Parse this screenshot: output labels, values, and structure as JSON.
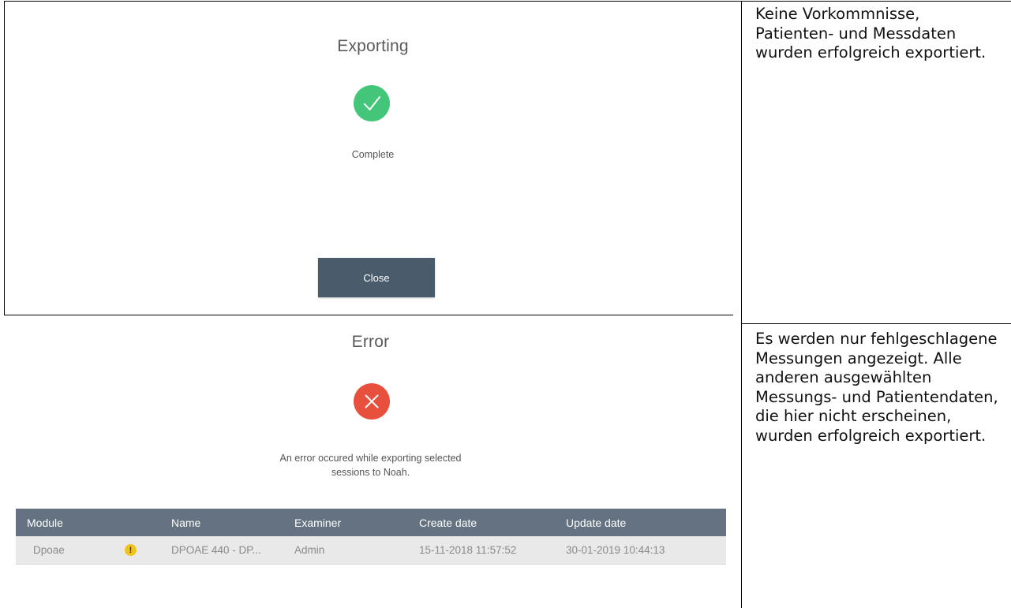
{
  "rows": [
    {
      "dialog": {
        "title": "Exporting",
        "icon": "check-circle-icon",
        "icon_color": "#44c67a",
        "status": "Complete",
        "button_label": "Close"
      },
      "description": "Keine Vorkommnisse, Patienten- und Messdaten wurden erfolgreich exportiert."
    },
    {
      "dialog": {
        "title": "Error",
        "icon": "error-circle-icon",
        "icon_color": "#e8503e",
        "message_line1": "An error occured while exporting selected",
        "message_line2": "sessions to Noah.",
        "table": {
          "header_bg": "#647282",
          "columns": [
            "Module",
            "Name",
            "Examiner",
            "Create date",
            "Update date"
          ],
          "rows": [
            {
              "module": "Dpoae",
              "status_icon": "warning-icon",
              "name": "DPOAE 440 - DP...",
              "examiner": "Admin",
              "create_date": "15-11-2018 11:57:52",
              "update_date": "30-01-2019 10:44:13"
            }
          ]
        }
      },
      "description": "Es werden nur fehlgeschlagene Messungen angezeigt. Alle anderen ausgewählten Messungs- und Patientendaten, die hier nicht erscheinen, wurden erfolgreich exportiert."
    }
  ]
}
